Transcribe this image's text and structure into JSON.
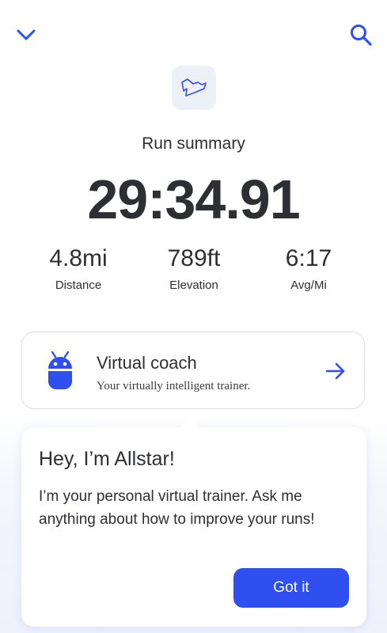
{
  "header": {
    "collapse_icon": "chevron-down-icon",
    "search_icon": "search-icon",
    "accent_color": "#2f4ff0"
  },
  "summary": {
    "route_icon": "route-map-icon",
    "title": "Run summary",
    "time": "29:34.91",
    "stats": [
      {
        "value": "4.8mi",
        "label": "Distance"
      },
      {
        "value": "789ft",
        "label": "Elevation"
      },
      {
        "value": "6:17",
        "label": "Avg/Mi"
      }
    ]
  },
  "coach": {
    "icon": "robot-icon",
    "title": "Virtual coach",
    "subtitle": "Your virtually intelligent trainer.",
    "arrow_icon": "arrow-right-icon"
  },
  "popup": {
    "title": "Hey, I’m Allstar!",
    "body": "I’m your personal virtual trainer. Ask me anything about how to improve your runs!",
    "button_label": "Got it",
    "button_color": "#2f4ff0"
  }
}
